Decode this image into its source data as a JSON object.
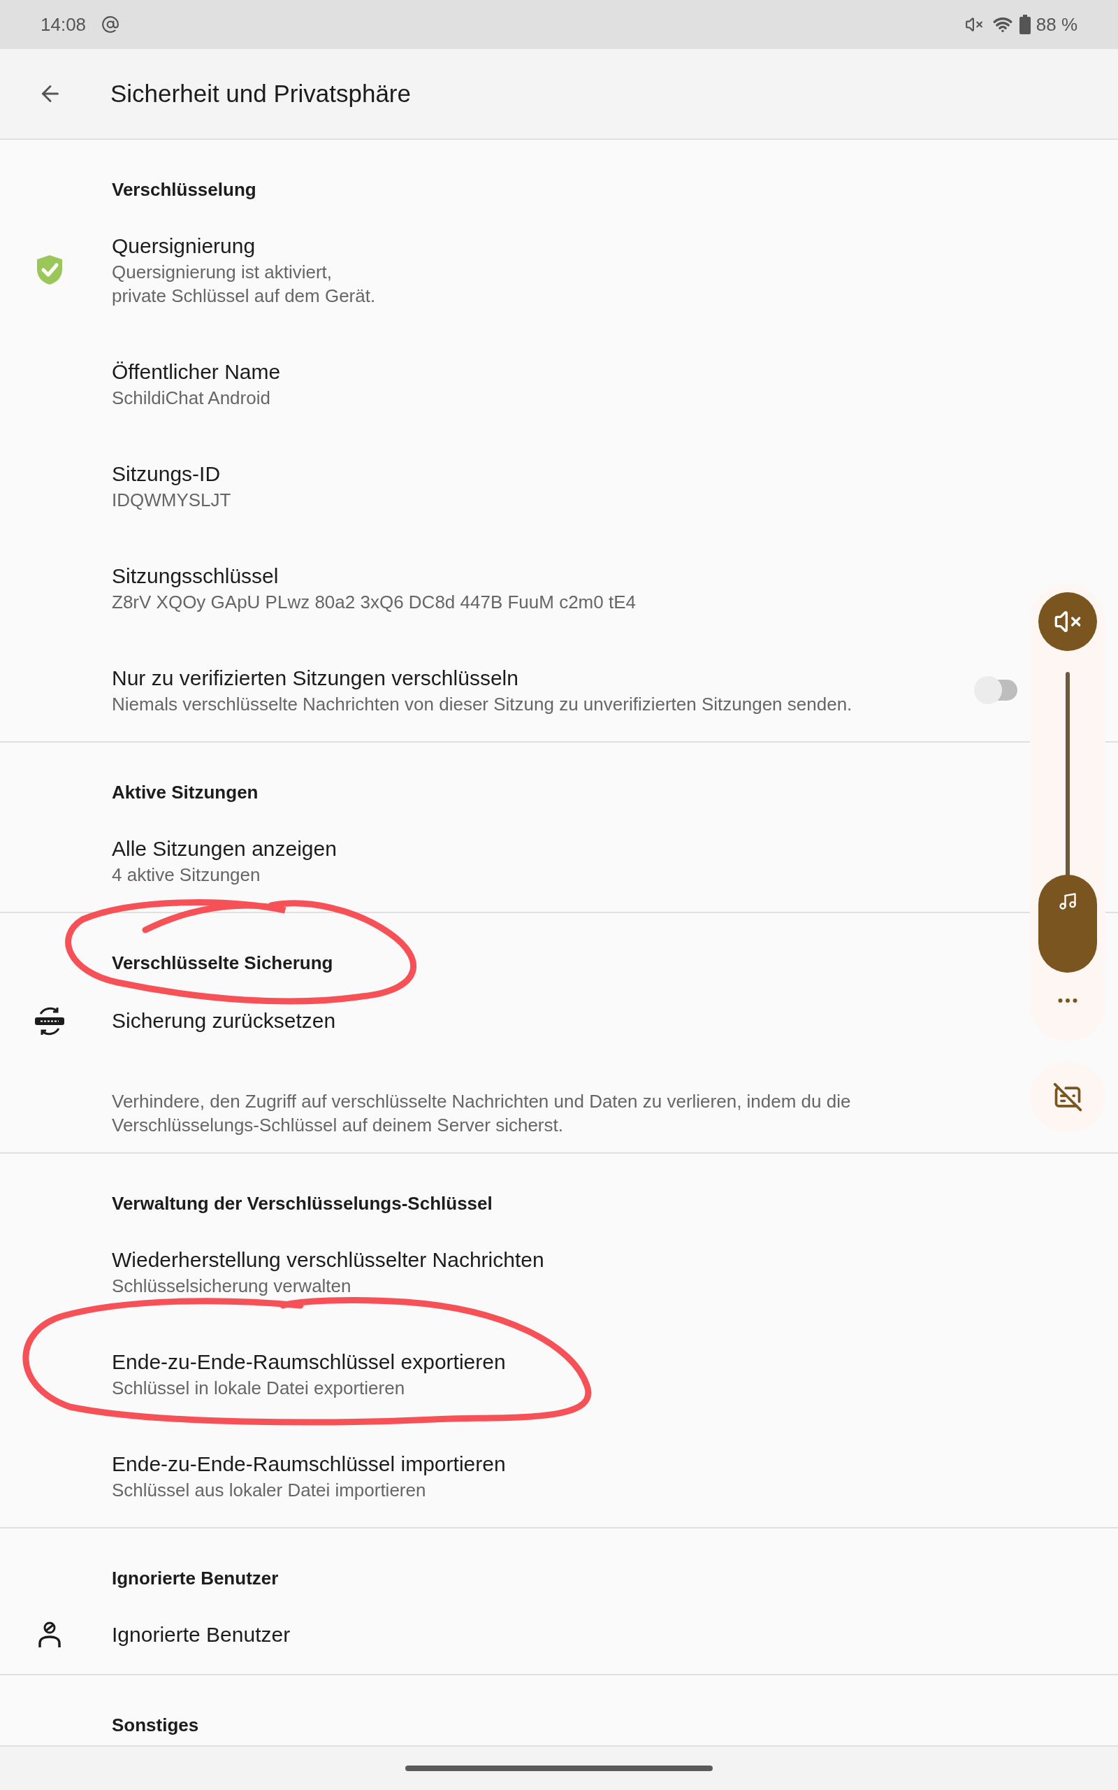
{
  "status_bar": {
    "time": "14:08",
    "battery": "88 %"
  },
  "app_bar": {
    "title": "Sicherheit und Privatsphäre"
  },
  "sections": [
    {
      "header": "Verschlüsselung",
      "circled": false,
      "items": [
        {
          "kind": "entry",
          "title": "Quersignierung",
          "subtitle": "Quersignierung ist aktiviert,\nprivate Schlüssel auf dem Gerät.",
          "circled": false
        },
        {
          "kind": "entry",
          "title": "Öffentlicher Name",
          "subtitle": "SchildiChat Android",
          "circled": false
        },
        {
          "kind": "entry",
          "title": "Sitzungs-ID",
          "subtitle": "IDQWMYSLJT",
          "circled": false
        },
        {
          "kind": "entry",
          "title": "Sitzungsschlüssel",
          "subtitle": "Z8rV XQOy GApU PLwz 80a2 3xQ6 DC8d 447B FuuM c2m0 tE4",
          "circled": false
        },
        {
          "kind": "switch",
          "title": "Nur zu verifizierten Sitzungen verschlüsseln",
          "subtitle": "Niemals verschlüsselte Nachrichten von dieser Sitzung zu unverifizierten Sitzungen senden.",
          "on": false,
          "circled": false
        }
      ]
    },
    {
      "header": "Aktive Sitzungen",
      "circled": false,
      "items": [
        {
          "kind": "entry",
          "title": "Alle Sitzungen anzeigen",
          "subtitle": "4 aktive Sitzungen",
          "circled": false
        }
      ]
    },
    {
      "header": "Verschlüsselte Sicherung",
      "circled": true,
      "items": [
        {
          "kind": "entry",
          "title": "Sicherung zurücksetzen",
          "circled": false
        },
        {
          "kind": "note",
          "subtitle": "Verhindere, den Zugriff auf verschlüsselte Nachrichten und Daten zu verlieren, indem du die\nVerschlüsselungs-Schlüssel auf deinem Server sicherst.",
          "circled": false
        }
      ]
    },
    {
      "header": "Verwaltung der Verschlüsselungs-Schlüssel",
      "circled": false,
      "items": [
        {
          "kind": "entry",
          "title": "Wiederherstellung verschlüsselter Nachrichten",
          "subtitle": "Schlüsselsicherung verwalten",
          "circled": false
        },
        {
          "kind": "entry",
          "title": "Ende-zu-Ende-Raumschlüssel exportieren",
          "subtitle": "Schlüssel in lokale Datei exportieren",
          "circled": true
        },
        {
          "kind": "entry",
          "title": "Ende-zu-Ende-Raumschlüssel importieren",
          "subtitle": "Schlüssel aus lokaler Datei importieren",
          "circled": false
        }
      ]
    },
    {
      "header": "Ignorierte Benutzer",
      "circled": false,
      "items": [
        {
          "kind": "entry",
          "title": "Ignorierte Benutzer",
          "circled": false
        }
      ]
    },
    {
      "header": "Sonstiges"
    }
  ],
  "volume_panel": {
    "muted": true,
    "level": 0,
    "captions_on": false
  }
}
